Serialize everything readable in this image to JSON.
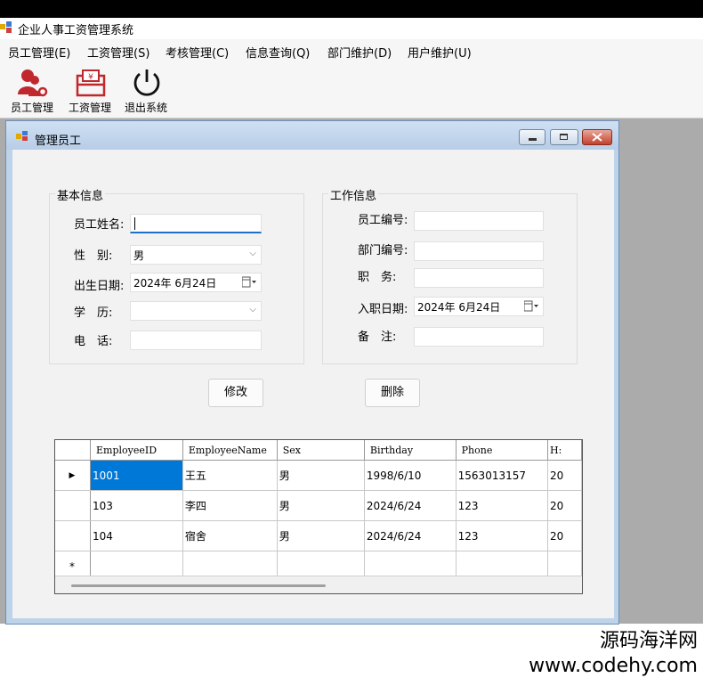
{
  "app": {
    "title": "企业人事工资管理系统"
  },
  "menu": [
    {
      "label": "员工管理(E)"
    },
    {
      "label": "工资管理(S)"
    },
    {
      "label": "考核管理(C)"
    },
    {
      "label": "信息查询(Q)"
    },
    {
      "label": "部门维护(D)"
    },
    {
      "label": "用户维护(U)"
    }
  ],
  "toolbar": [
    {
      "label": "员工管理",
      "icon": "employee-icon"
    },
    {
      "label": "工资管理",
      "icon": "salary-icon"
    },
    {
      "label": "退出系统",
      "icon": "power-icon"
    }
  ],
  "child": {
    "title": "管理员工"
  },
  "basic": {
    "title": "基本信息",
    "name_label": "员工姓名:",
    "name_value": "",
    "gender_label": "性　别:",
    "gender_value": "男",
    "birth_label": "出生日期:",
    "birth_value": "2024年  6月24日",
    "edu_label": "学　历:",
    "edu_value": "",
    "phone_label": "电　话:",
    "phone_value": ""
  },
  "work": {
    "title": "工作信息",
    "id_label": "员工编号:",
    "id_value": "",
    "dept_label": "部门编号:",
    "dept_value": "",
    "job_label": "职　务:",
    "job_value": "",
    "hire_label": "入职日期:",
    "hire_value": "2024年  6月24日",
    "note_label": "备　注:",
    "note_value": ""
  },
  "buttons": {
    "modify": "修改",
    "delete": "删除"
  },
  "grid": {
    "columns": [
      "EmployeeID",
      "EmployeeName",
      "Sex",
      "Birthday",
      "Phone",
      "H:"
    ],
    "rows": [
      {
        "marker": "▶",
        "cells": [
          "1001",
          "王五",
          "男",
          "1998/6/10",
          "1563013157",
          "20"
        ]
      },
      {
        "marker": "",
        "cells": [
          "103",
          "李四",
          "男",
          "2024/6/24",
          "123",
          "20"
        ]
      },
      {
        "marker": "",
        "cells": [
          "104",
          "宿舍",
          "男",
          "2024/6/24",
          "123",
          "20"
        ]
      }
    ],
    "new_row_marker": "*"
  },
  "watermark": {
    "line1": "源码海洋网",
    "line2": "www.codehy.com"
  },
  "colors": {
    "selection": "#0078d7",
    "mdi_background": "#ababab",
    "accent_red": "#c0282e"
  }
}
